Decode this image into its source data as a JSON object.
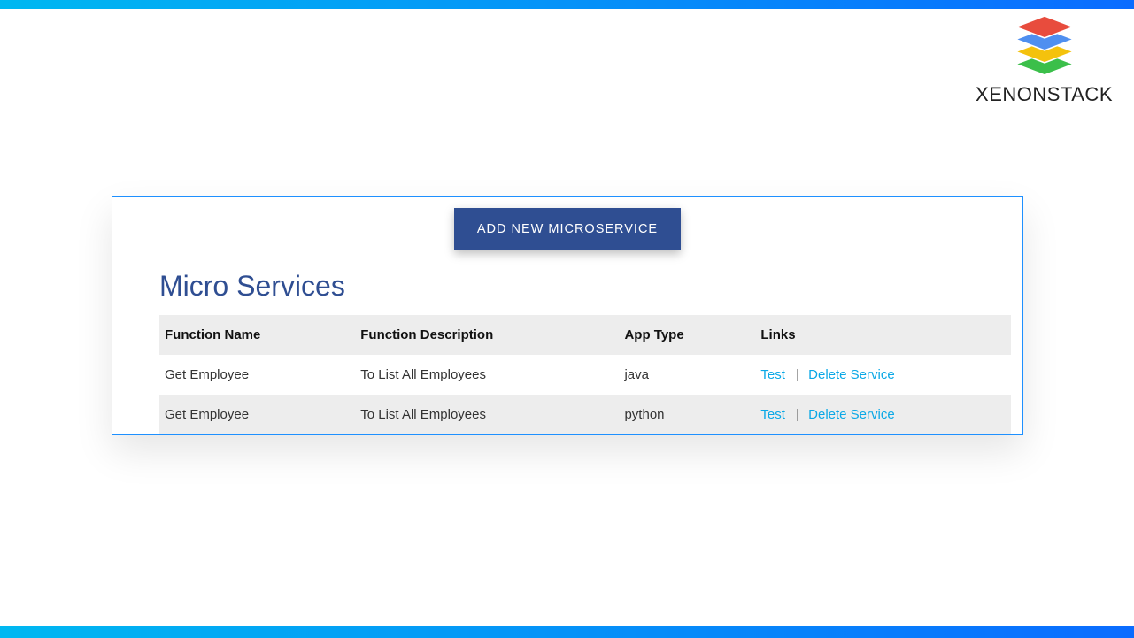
{
  "brand": {
    "name": "XENONSTACK"
  },
  "panel": {
    "add_button_label": "ADD NEW MICROSERVICE",
    "title": "Micro Services",
    "columns": {
      "name": "Function Name",
      "desc": "Function Description",
      "type": "App Type",
      "links": "Links"
    },
    "link_labels": {
      "test": "Test",
      "delete": "Delete Service",
      "sep": "|"
    },
    "rows": [
      {
        "name": "Get Employee",
        "desc": "To List All Employees",
        "type": "java"
      },
      {
        "name": "Get Employee",
        "desc": "To List All Employees",
        "type": "python"
      }
    ]
  }
}
